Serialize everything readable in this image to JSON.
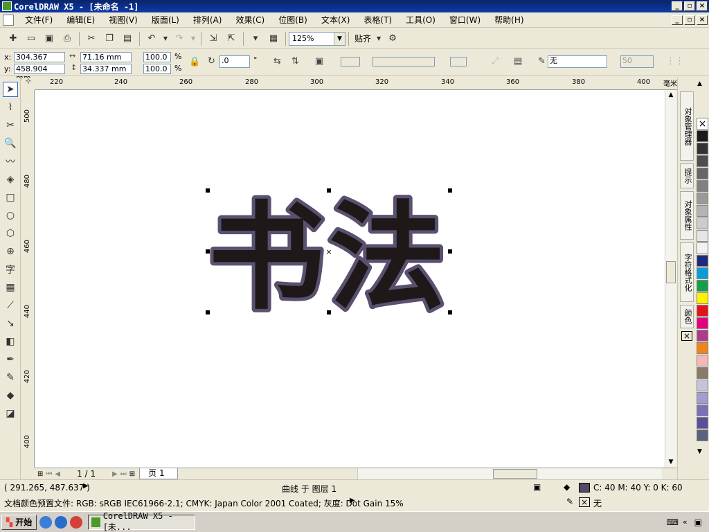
{
  "window": {
    "title": "CorelDRAW X5 - [未命名 -1]",
    "min": "_",
    "max": "▫",
    "close": "×"
  },
  "menu": [
    "文件(F)",
    "编辑(E)",
    "视图(V)",
    "版面(L)",
    "排列(A)",
    "效果(C)",
    "位图(B)",
    "文本(X)",
    "表格(T)",
    "工具(O)",
    "窗口(W)",
    "帮助(H)"
  ],
  "toolbar": {
    "zoom": "125%",
    "snap": "贴齐"
  },
  "propbar": {
    "x_label": "x:",
    "x_value": "304.367 mm",
    "y_label": "y:",
    "y_value": "458.904 mm",
    "w_value": "71.16 mm",
    "h_value": "34.337 mm",
    "sx_value": "100.0",
    "sy_value": "100.0",
    "pct": "%",
    "rotation": ".0",
    "degree": "°",
    "outline_value": "无",
    "size_value": "50"
  },
  "ruler": {
    "top": [
      "220",
      "240",
      "260",
      "280",
      "300",
      "320",
      "340",
      "360",
      "380",
      "400"
    ],
    "left": [
      "500",
      "480",
      "460",
      "440",
      "420",
      "400"
    ],
    "unit": "毫米"
  },
  "artwork": {
    "text": "书法",
    "fill": "#1e1818",
    "outline": "#5a5070"
  },
  "pagenav": {
    "pages": "1 / 1",
    "tab": "页 1"
  },
  "dockers": [
    "对象管理器",
    "提示",
    "对象属性",
    "字符格式化",
    "颜色"
  ],
  "palette": [
    "#ffffff",
    "#1a1a1a",
    "#333333",
    "#4d4d4d",
    "#666666",
    "#808080",
    "#999999",
    "#b3b3b3",
    "#cccccc",
    "#e6e6e6",
    "#f2f2f2",
    "#1f2a7a",
    "#0a9cd8",
    "#13a04a",
    "#fff200",
    "#e3131b",
    "#e4007f",
    "#b03a8a",
    "#f08519",
    "#f6b7b7",
    "#8a7a6a",
    "#c8c3dd",
    "#a69bd0",
    "#7d6fb8",
    "#5b4f9a",
    "#58627e"
  ],
  "status": {
    "coords": "( 291.265, 487.637 )",
    "object": "曲线 于 图层 1",
    "fill_info": "C: 40 M: 40 Y: 0 K: 60",
    "profile": "文档颜色预置文件: RGB: sRGB IEC61966-2.1; CMYK: Japan Color 2001 Coated; 灰度: Dot Gain 15%",
    "outline_info": "无"
  },
  "colors": {
    "fill_swatch": "#534a6a"
  },
  "taskbar": {
    "start": "开始",
    "task": "CorelDRAW X5 - [未..."
  }
}
